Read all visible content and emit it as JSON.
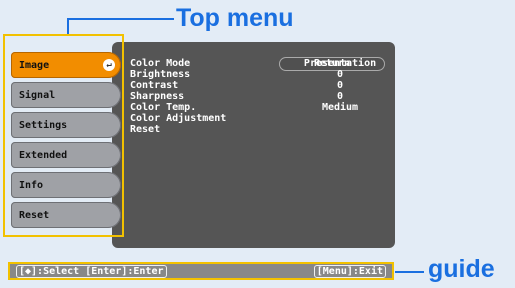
{
  "callouts": {
    "top": "Top menu",
    "bottom": "guide"
  },
  "sidebar": {
    "items": [
      {
        "label": "Image",
        "active": true
      },
      {
        "label": "Signal"
      },
      {
        "label": "Settings"
      },
      {
        "label": "Extended"
      },
      {
        "label": "Info"
      },
      {
        "label": "Reset"
      }
    ],
    "enter_icon": "enter-icon"
  },
  "submenu": {
    "return_label": "Return",
    "rows": [
      {
        "label": "Color Mode",
        "value": "Presentation"
      },
      {
        "label": "Brightness",
        "value": "0"
      },
      {
        "label": "Contrast",
        "value": "0"
      },
      {
        "label": "Sharpness",
        "value": "0"
      },
      {
        "label": "Color Temp.",
        "value": "Medium"
      },
      {
        "label": "Color Adjustment",
        "value": ""
      },
      {
        "label": "Reset",
        "value": ""
      }
    ]
  },
  "guide": {
    "left": "[◆]:Select [Enter]:Enter",
    "right": "[Menu]:Exit"
  },
  "colors": {
    "accent": "#1a6fe0",
    "frame": "#f2c100",
    "active": "#f28d00"
  }
}
